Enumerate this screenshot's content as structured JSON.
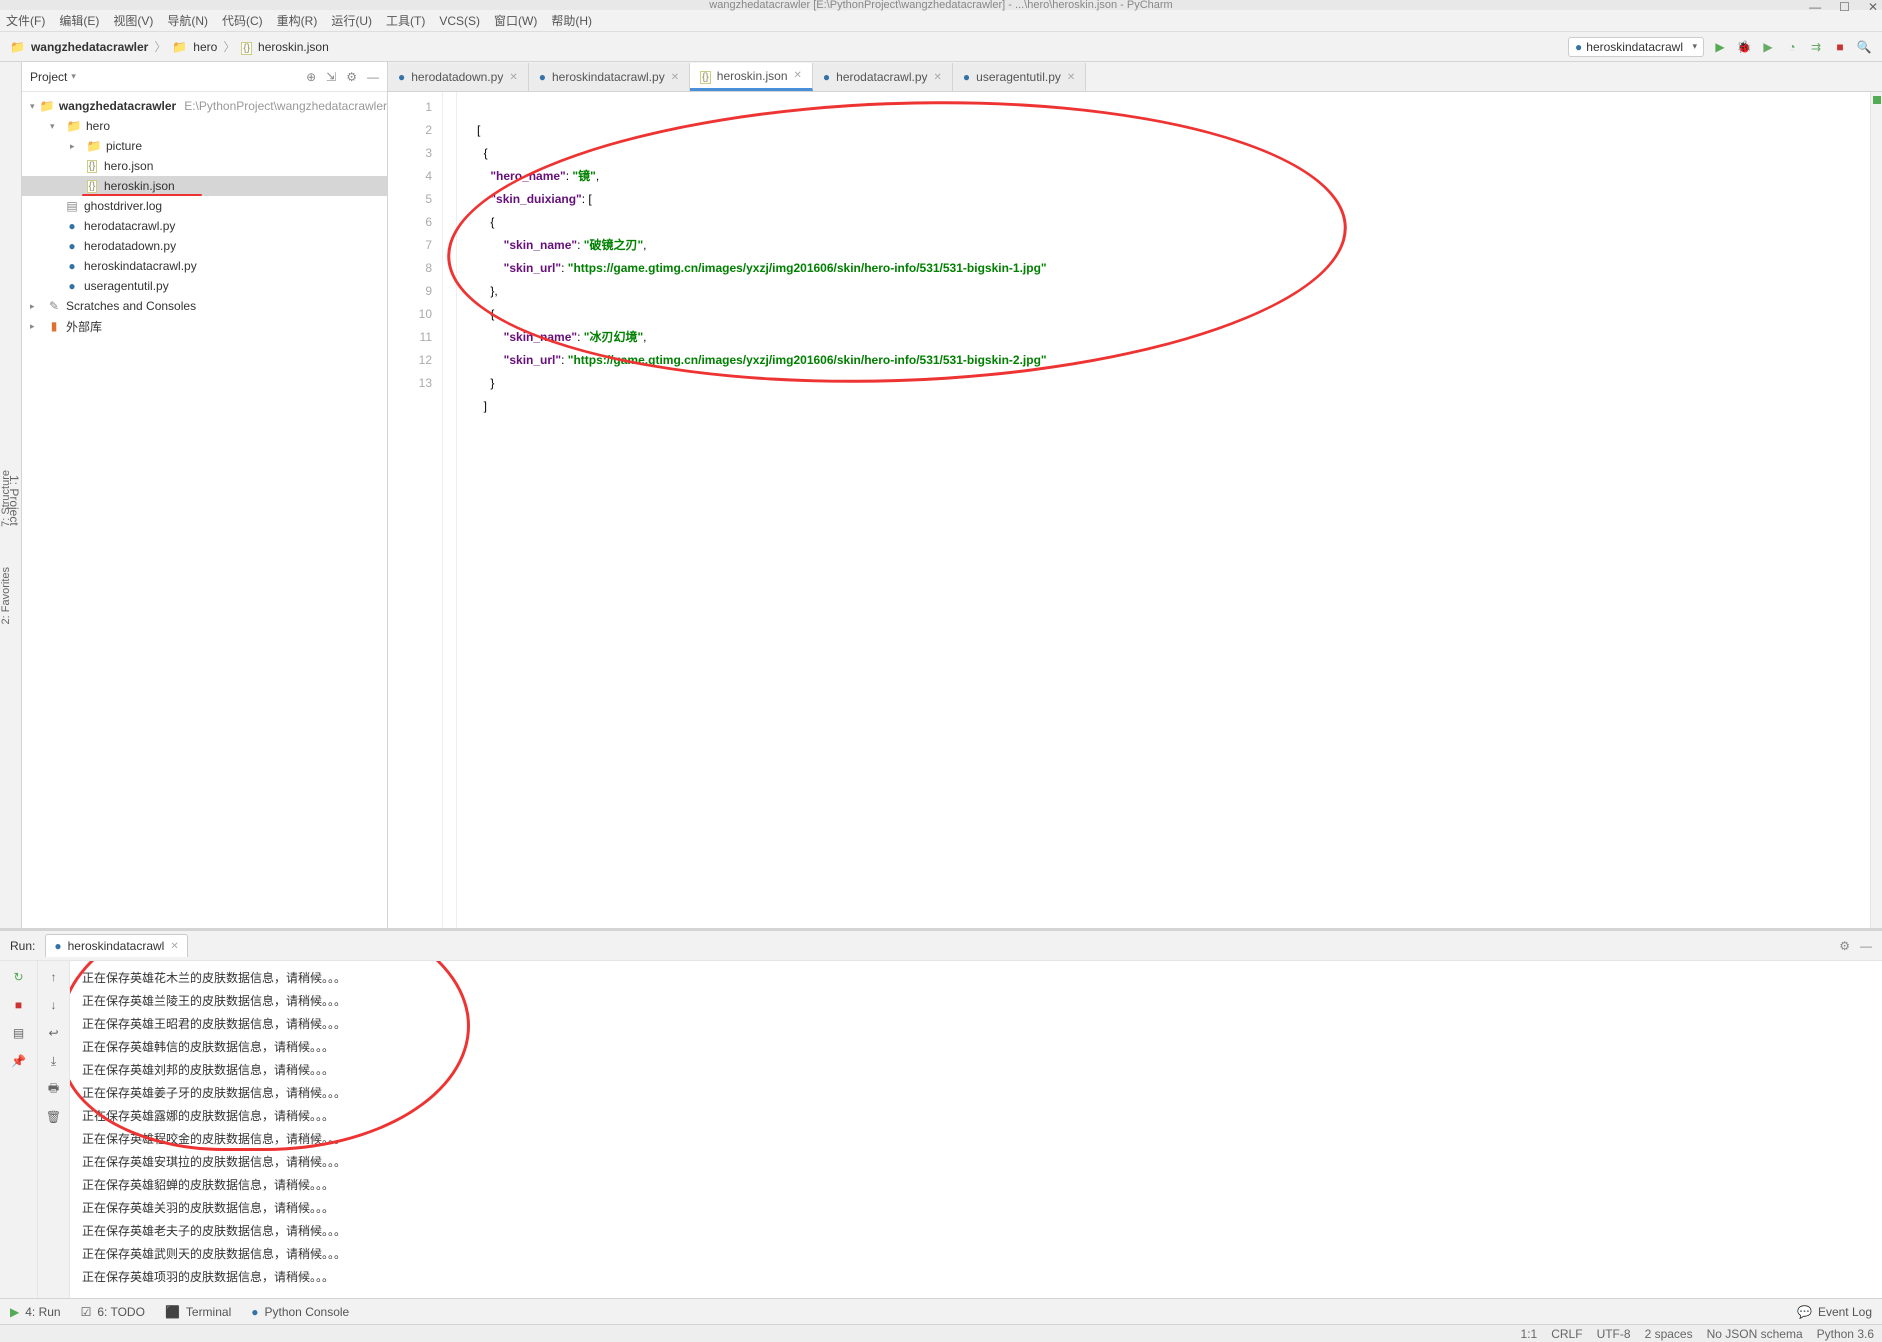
{
  "window": {
    "title": "wangzhedatacrawler [E:\\PythonProject\\wangzhedatacrawler] - ...\\hero\\heroskin.json - PyCharm"
  },
  "menubar": [
    "文件(F)",
    "编辑(E)",
    "视图(V)",
    "导航(N)",
    "代码(C)",
    "重构(R)",
    "运行(U)",
    "工具(T)",
    "VCS(S)",
    "窗口(W)",
    "帮助(H)"
  ],
  "breadcrumb": [
    "wangzhedatacrawler",
    "hero",
    "heroskin.json"
  ],
  "runconfig": "heroskindatacrawl",
  "project": {
    "title": "Project",
    "root": {
      "name": "wangzhedatacrawler",
      "hint": "E:\\PythonProject\\wangzhedatacrawler"
    },
    "hero_folder": "hero",
    "picture_folder": "picture",
    "files": [
      "hero.json",
      "heroskin.json",
      "ghostdriver.log",
      "herodatacrawl.py",
      "herodatadown.py",
      "heroskindatacrawl.py",
      "useragentutil.py"
    ],
    "scratches": "Scratches and Consoles",
    "ext_lib": "外部库"
  },
  "tabs": [
    {
      "name": "herodatadown.py",
      "icon": "py"
    },
    {
      "name": "heroskindatacrawl.py",
      "icon": "py"
    },
    {
      "name": "heroskin.json",
      "icon": "json",
      "active": true
    },
    {
      "name": "herodatacrawl.py",
      "icon": "py"
    },
    {
      "name": "useragentutil.py",
      "icon": "py"
    }
  ],
  "code": {
    "lines": [
      1,
      2,
      3,
      4,
      5,
      6,
      7,
      8,
      9,
      10,
      11,
      12,
      13
    ],
    "l1": "[",
    "l2": "  {",
    "l3k": "\"hero_name\"",
    "l3c": ": ",
    "l3s": "\"镜\"",
    "l3t": ",",
    "l4k": "\"skin_duixiang\"",
    "l4c": ": [",
    "l5": "    {",
    "l6k": "\"skin_name\"",
    "l6c": ": ",
    "l6s": "\"破镜之刃\"",
    "l6t": ",",
    "l7k": "\"skin_url\"",
    "l7c": ": ",
    "l7s": "\"https://game.gtimg.cn/images/yxzj/img201606/skin/hero-info/531/531-bigskin-1.jpg\"",
    "l8": "    },",
    "l9": "    {",
    "l10k": "\"skin_name\"",
    "l10c": ": ",
    "l10s": "\"冰刃幻境\"",
    "l10t": ",",
    "l11k": "\"skin_url\"",
    "l11c": ": ",
    "l11s": "\"https://game.gtimg.cn/images/yxzj/img201606/skin/hero-info/531/531-bigskin-2.jpg\"",
    "l12": "    }",
    "l13": "  ]"
  },
  "run": {
    "label": "Run:",
    "tabname": "heroskindatacrawl",
    "lines": [
      "正在保存英雄花木兰的皮肤数据信息，请稍候。。。",
      "正在保存英雄兰陵王的皮肤数据信息，请稍候。。。",
      "正在保存英雄王昭君的皮肤数据信息，请稍候。。。",
      "正在保存英雄韩信的皮肤数据信息，请稍候。。。",
      "正在保存英雄刘邦的皮肤数据信息，请稍候。。。",
      "正在保存英雄姜子牙的皮肤数据信息，请稍候。。。",
      "正在保存英雄露娜的皮肤数据信息，请稍候。。。",
      "正在保存英雄程咬金的皮肤数据信息，请稍候。。。",
      "正在保存英雄安琪拉的皮肤数据信息，请稍候。。。",
      "正在保存英雄貂蝉的皮肤数据信息，请稍候。。。",
      "正在保存英雄关羽的皮肤数据信息，请稍候。。。",
      "正在保存英雄老夫子的皮肤数据信息，请稍候。。。",
      "正在保存英雄武则天的皮肤数据信息，请稍候。。。",
      "正在保存英雄项羽的皮肤数据信息，请稍候。。。"
    ]
  },
  "bottombar": {
    "run": "4: Run",
    "todo": "6: TODO",
    "terminal": "Terminal",
    "pyconsole": "Python Console",
    "eventlog": "Event Log"
  },
  "status": {
    "pos": "1:1",
    "enc": "CRLF",
    "charset": "UTF-8",
    "indent": "2 spaces",
    "schema": "No JSON schema",
    "python": "Python 3.6"
  },
  "left_tabs": {
    "project": "1: Project",
    "structure": "7: Structure",
    "favorites": "2: Favorites"
  }
}
